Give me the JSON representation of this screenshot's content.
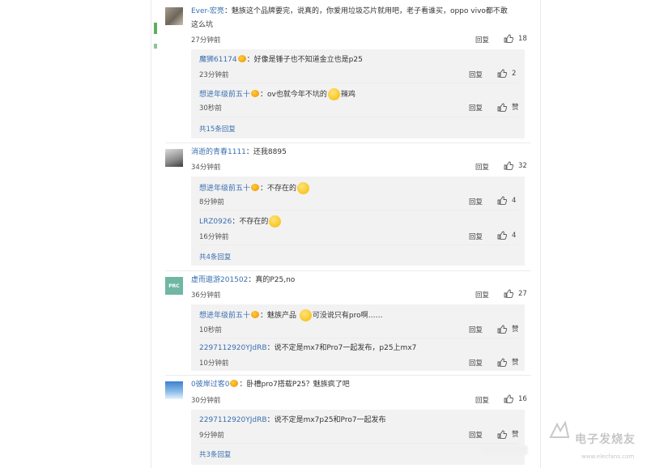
{
  "comments": [
    {
      "user": "Ever-宏亮",
      "text_line1": "：魅族这个品牌要完，说真的，你爱用垃圾芯片就用吧，老子看谁买，oppo vivo都不敢",
      "text_line2": "这么坑",
      "time": "27分钟前",
      "reply_label": "回复",
      "likes": "18",
      "replies": [
        {
          "user": "魔狮61174",
          "text": "：好像是锤子也不知道金立也是p25",
          "time": "23分钟前",
          "reply_label": "回复",
          "likes": "2"
        },
        {
          "user": "想进年级前五十",
          "text": "：ov也就今年不坑的",
          "emoji_text": "辣鸡",
          "time": "30秒前",
          "reply_label": "回复",
          "likes": "赞"
        }
      ],
      "more": "共15条回复"
    },
    {
      "user": "消逝的青春1111",
      "text_line1": "：还我8895",
      "time": "34分钟前",
      "reply_label": "回复",
      "likes": "32",
      "replies": [
        {
          "user": "想进年级前五十",
          "text": "：不存在的",
          "time": "8分钟前",
          "reply_label": "回复",
          "likes": "4"
        },
        {
          "user": "LRZ0926",
          "text": "：不存在的",
          "time": "16分钟前",
          "reply_label": "回复",
          "likes": "4"
        }
      ],
      "more": "共4条回复"
    },
    {
      "user": "虚而遨游201502",
      "text_line1": "：真的P25,no",
      "time": "36分钟前",
      "reply_label": "回复",
      "likes": "27",
      "avatar_text": "PRC",
      "replies": [
        {
          "user": "想进年级前五十",
          "text": "：魅族产品",
          "text_after": "可没说只有pro啊……",
          "time": "10秒前",
          "reply_label": "回复",
          "likes": "赞"
        },
        {
          "user": "2297112920YJdRB",
          "text": "：说不定是mx7和Pro7一起发布，p25上mx7",
          "time": "10分钟前",
          "reply_label": "回复",
          "likes": "赞"
        }
      ]
    },
    {
      "user": "0彼岸过客0",
      "text_line1": "：卧槽pro7搭载P25？魅族疯了吧",
      "time": "30分钟前",
      "reply_label": "回复",
      "likes": "16",
      "replies": [
        {
          "user": "2297112920YJdRB",
          "text": "：说不定是mx7p25和Pro7一起发布",
          "time": "9分钟前",
          "reply_label": "回复",
          "likes": "赞"
        }
      ],
      "more": "共3条回复"
    }
  ],
  "watermark": {
    "title": "电子发烧友",
    "sub": "www.elecfans.com"
  },
  "icons": {
    "like": "thumbs-up-icon",
    "badge": "member-badge-icon",
    "emoji": "emoji-face-icon"
  }
}
